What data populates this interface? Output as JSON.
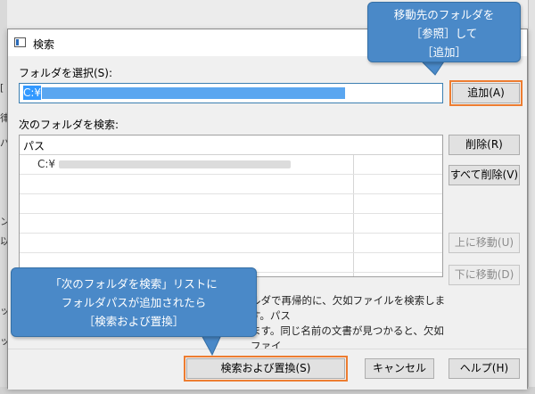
{
  "dialog": {
    "title": "検索",
    "select_folder_label": "フォルダを選択(S):",
    "folder_value": "C:¥",
    "add_button": "追加(A)",
    "search_list_label": "次のフォルダを検索:",
    "table_header_path": "パス",
    "rows": [
      {
        "path": "C:¥"
      },
      {
        "path": ""
      },
      {
        "path": ""
      },
      {
        "path": ""
      },
      {
        "path": ""
      },
      {
        "path": ""
      }
    ],
    "delete_button": "削除(R)",
    "delete_all_button": "すべて削除(V)",
    "move_up_button": "上に移動(U)",
    "move_down_button": "下に移動(D)",
    "description_line1": "ルダで再帰的に、欠如ファイルを検索します。パス",
    "description_line2": "ます。同じ名前の文書が見つかると、欠如ファイ",
    "search_replace_button": "検索および置換(S)",
    "cancel_button": "キャンセル",
    "help_button": "ヘルプ(H)"
  },
  "callout_top": {
    "line1": "移動先のフォルダを",
    "line2": "［参照］して",
    "line3": "［追加］"
  },
  "callout_bottom": {
    "line1": "「次のフォルダを検索」リストに",
    "line2": "フォルダパスが追加されたら",
    "line3": "［検索および置換］"
  },
  "background_glyphs": [
    "[",
    "律",
    "バ",
    "ン",
    "以",
    "ッ",
    "ッ"
  ],
  "colors": {
    "accent_highlight": "#ed7d31",
    "callout_fill": "#4a89c8",
    "selection": "#3399ff"
  }
}
